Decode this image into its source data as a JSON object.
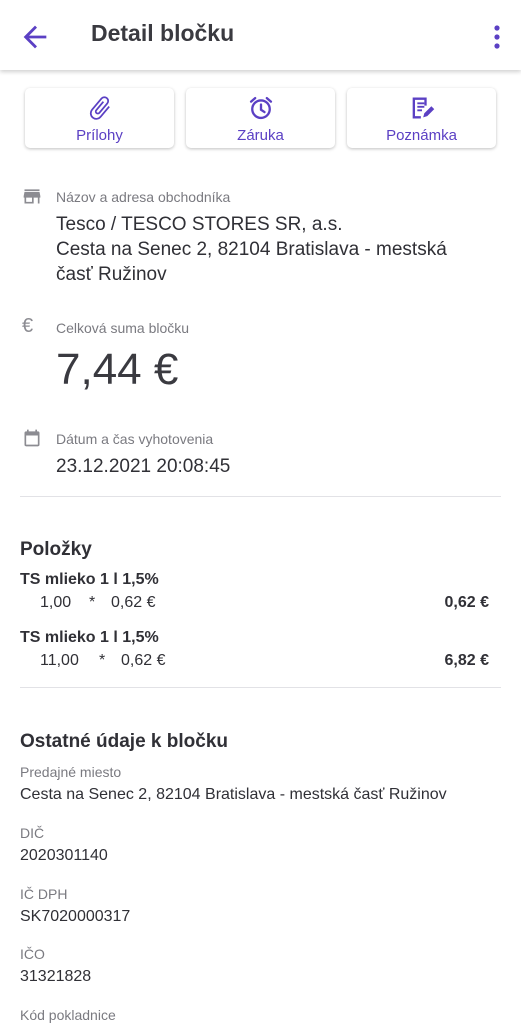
{
  "appbar": {
    "title": "Detail bločku",
    "back_icon": "arrow-left-icon",
    "more_icon": "more-vert-icon"
  },
  "accent_color": "#5b40c4",
  "actions": [
    {
      "label": "Prílohy",
      "icon": "paperclip-icon"
    },
    {
      "label": "Záruka",
      "icon": "alarm-clock-icon"
    },
    {
      "label": "Poznámka",
      "icon": "note-edit-icon"
    }
  ],
  "merchant": {
    "label": "Názov a adresa obchodníka",
    "line1": "Tesco / TESCO STORES SR, a.s.",
    "line2": "Cesta na Senec 2, 82104 Bratislava - mestská",
    "line3": "časť Ružinov",
    "icon": "store-icon"
  },
  "total": {
    "label": "Celková suma bločku",
    "value": "7,44 €",
    "icon": "euro-icon"
  },
  "datetime": {
    "label": "Dátum a čas vyhotovenia",
    "value": "23.12.2021 20:08:45",
    "icon": "calendar-icon"
  },
  "items_section": {
    "title": "Položky",
    "items": [
      {
        "name": "TS mlieko 1 l 1,5%",
        "qty": "1,00",
        "times": "*",
        "unit_price": "0,62 €",
        "total": "0,62 €"
      },
      {
        "name": "TS mlieko 1 l 1,5%",
        "qty": "11,00",
        "times": "*",
        "unit_price": "0,62 €",
        "total": "6,82 €"
      }
    ]
  },
  "other_section": {
    "title": "Ostatné údaje k bločku",
    "fields": [
      {
        "label": "Predajné miesto",
        "value": "Cesta na Senec 2, 82104 Bratislava - mestská časť Ružinov"
      },
      {
        "label": "DIČ",
        "value": "2020301140"
      },
      {
        "label": "IČ DPH",
        "value": "SK7020000317"
      },
      {
        "label": "IČO",
        "value": "31321828"
      },
      {
        "label": "Kód pokladnice",
        "value": ""
      }
    ]
  }
}
